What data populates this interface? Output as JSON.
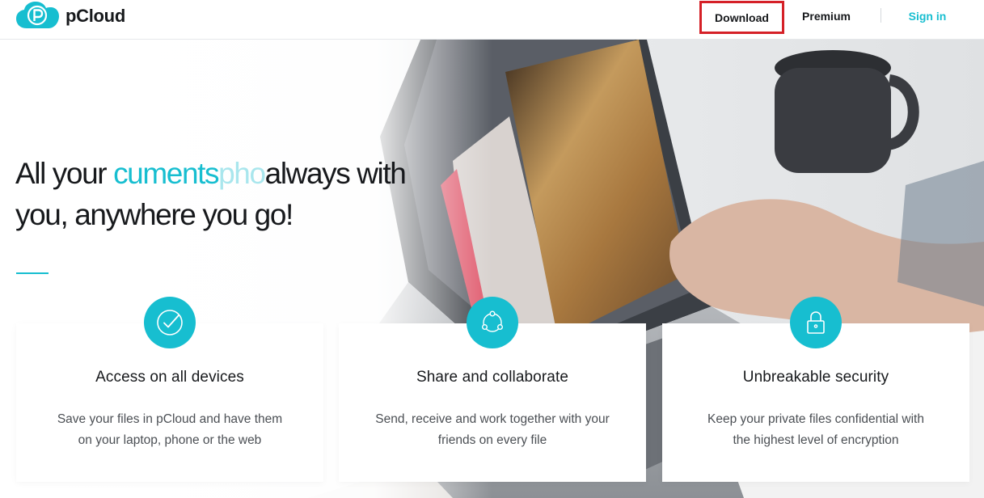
{
  "header": {
    "brand": "pCloud",
    "nav": {
      "download": "Download",
      "premium": "Premium",
      "signin": "Sign in"
    }
  },
  "hero": {
    "headline_start": "All your ",
    "headline_animated": "cuments",
    "headline_animated_faded": "pho",
    "headline_rest_line1": "always with",
    "headline_line2": "you, anywhere you go!"
  },
  "features": [
    {
      "icon": "check-circle-icon",
      "title": "Access on all devices",
      "desc_line1": "Save your files in pCloud and have them",
      "desc_line2": "on your laptop, phone or the web"
    },
    {
      "icon": "share-network-icon",
      "title": "Share and collaborate",
      "desc_line1": "Send, receive and work together with your",
      "desc_line2": "friends on every file"
    },
    {
      "icon": "lock-icon",
      "title": "Unbreakable security",
      "desc_line1": "Keep your private files confidential with",
      "desc_line2": "the highest level of encryption"
    }
  ],
  "colors": {
    "accent": "#17bed0",
    "highlight_box": "#d52027",
    "text": "#17191c"
  }
}
